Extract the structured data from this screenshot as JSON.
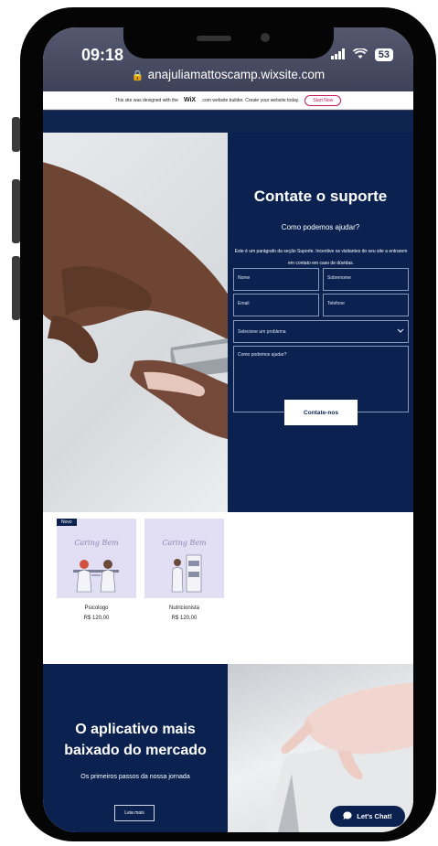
{
  "status_bar": {
    "time": "09:18",
    "battery": "53"
  },
  "browser": {
    "url": "anajuliamattoscamp.wixsite.com"
  },
  "wix_banner": {
    "text_before": "This site was designed with the",
    "wix_logo": "WiX",
    "text_after": ".com website builder. Create your website today.",
    "button": "Start Now"
  },
  "support": {
    "title": "Contate o suporte",
    "subtitle": "Como podemos ajudar?",
    "paragraph": "Este é um parágrafo da seção Suporte. Incentive os visitantes do seu site a entrarem em contato em caso de dúvidas.",
    "fields": {
      "name_placeholder": "Nome",
      "surname_placeholder": "Sobrenome",
      "email_placeholder": "Email",
      "phone_placeholder": "Telefone",
      "problem_select": "Selecione um problema",
      "message_placeholder": "Como podemos ajudar?"
    },
    "submit": "Contate-nos"
  },
  "products": [
    {
      "badge": "Novo",
      "brand": "Caring Bem",
      "name": "Psicologo",
      "price": "R$ 120,00"
    },
    {
      "badge": "",
      "brand": "Caring Bem",
      "name": "Nutricionista",
      "price": "R$ 120,00"
    }
  ],
  "app_section": {
    "title_line1": "O aplicativo mais",
    "title_line2": "baixado do mercado",
    "subtitle": "Os primeiros passos da nossa jornada",
    "button": "Leia mais"
  },
  "chat": {
    "label": "Let's Chat!"
  },
  "colors": {
    "navy": "#0b2250",
    "wix_pink": "#c2185b",
    "product_bg": "#e2def3"
  },
  "icons": {
    "lock": "lock-icon",
    "wifi": "wifi-icon",
    "chat": "chat-bubble-icon",
    "chevron": "chevron-down-icon"
  }
}
